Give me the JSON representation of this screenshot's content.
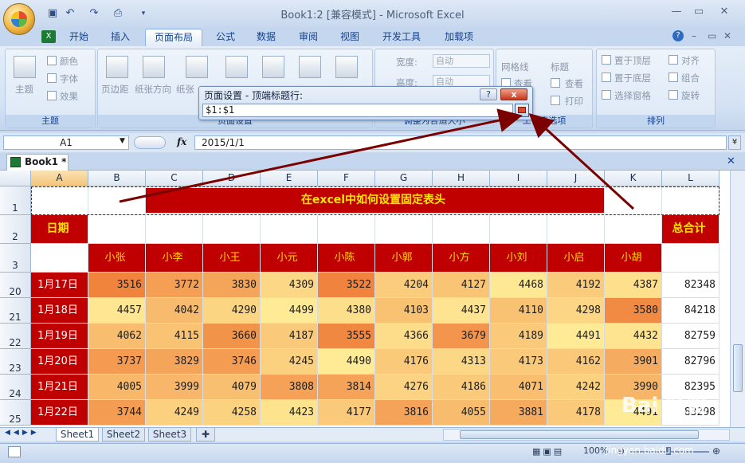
{
  "window": {
    "title": "Book1:2  [兼容模式] - Microsoft Excel"
  },
  "tabs": [
    "开始",
    "插入",
    "页面布局",
    "公式",
    "数据",
    "审阅",
    "视图",
    "开发工具",
    "加载项"
  ],
  "active_tab": "页面布局",
  "ribbon": {
    "theme_group": {
      "label": "主题",
      "big": "主题",
      "colors": "颜色",
      "fonts": "字体",
      "effects": "效果"
    },
    "pagesetup_group": {
      "label": "页面设置",
      "margins": "页边距",
      "orientation": "纸张方向",
      "size": "纸张"
    },
    "scale_group": {
      "label": "调整为合适大小",
      "width_label": "宽度:",
      "width_value": "自动",
      "height_label": "高度:",
      "height_value": "自动"
    },
    "sheetopts_group": {
      "label": "工作表选项",
      "gridlines": "网格线",
      "headings": "标题",
      "view1": "查看",
      "print1": "打印",
      "view2": "查看",
      "print2": "打印"
    },
    "arrange_group": {
      "label": "排列",
      "bring_front": "置于顶层",
      "send_back": "置于底层",
      "selection_pane": "选择窗格",
      "align": "对齐",
      "group": "组合",
      "rotate": "旋转"
    }
  },
  "formula_bar": {
    "name_box": "A1",
    "fx": "fx",
    "value": "2015/1/1"
  },
  "doc_tab": "Book1 *",
  "dialog": {
    "title": "页面设置 - 顶端标题行:",
    "help": "?",
    "close": "x",
    "value": "$1:$1"
  },
  "columns": [
    "A",
    "B",
    "C",
    "D",
    "E",
    "F",
    "G",
    "H",
    "I",
    "J",
    "K",
    "L"
  ],
  "sheet": {
    "title": "在excel中如何设置固定表头",
    "date_header": "日期",
    "total_header": "总合计",
    "names": [
      "小张",
      "小李",
      "小王",
      "小元",
      "小陈",
      "小郭",
      "小方",
      "小刘",
      "小启",
      "小胡"
    ],
    "rows": [
      {
        "row": "20",
        "date": "1月17日",
        "values": [
          3516,
          3772,
          3830,
          4309,
          3522,
          4204,
          4127,
          4468,
          4192,
          4387
        ],
        "total": 82348
      },
      {
        "row": "21",
        "date": "1月18日",
        "values": [
          4457,
          4042,
          4290,
          4499,
          4380,
          4103,
          4437,
          4110,
          4298,
          3580
        ],
        "total": 84218
      },
      {
        "row": "22",
        "date": "1月19日",
        "values": [
          4062,
          4115,
          3660,
          4187,
          3555,
          4366,
          3679,
          4189,
          4491,
          4432
        ],
        "total": 82759
      },
      {
        "row": "23",
        "date": "1月20日",
        "values": [
          3737,
          3829,
          3746,
          4245,
          4490,
          4176,
          4313,
          4173,
          4162,
          3901
        ],
        "total": 82796
      },
      {
        "row": "24",
        "date": "1月21日",
        "values": [
          4005,
          3999,
          4079,
          3808,
          3814,
          4276,
          4186,
          4071,
          4242,
          3990
        ],
        "total": 82395
      },
      {
        "row": "25",
        "date": "1月22日",
        "values": [
          3744,
          4249,
          4258,
          4423,
          4177,
          3816,
          4055,
          3881,
          4178,
          4491
        ],
        "total": 83298
      }
    ],
    "header_rows": [
      "1",
      "2",
      "3"
    ]
  },
  "sheet_tabs": [
    "Sheet1",
    "Sheet2",
    "Sheet3"
  ],
  "status": {
    "zoom": "100%"
  },
  "watermark": {
    "text": "Bai 经验",
    "url": "jingyan.baidu.com"
  },
  "colors": {
    "accent_red": "#c00000",
    "title_yellow": "#ffe600",
    "heat_low": "#f8696b",
    "heat_high": "#ffeb84"
  }
}
